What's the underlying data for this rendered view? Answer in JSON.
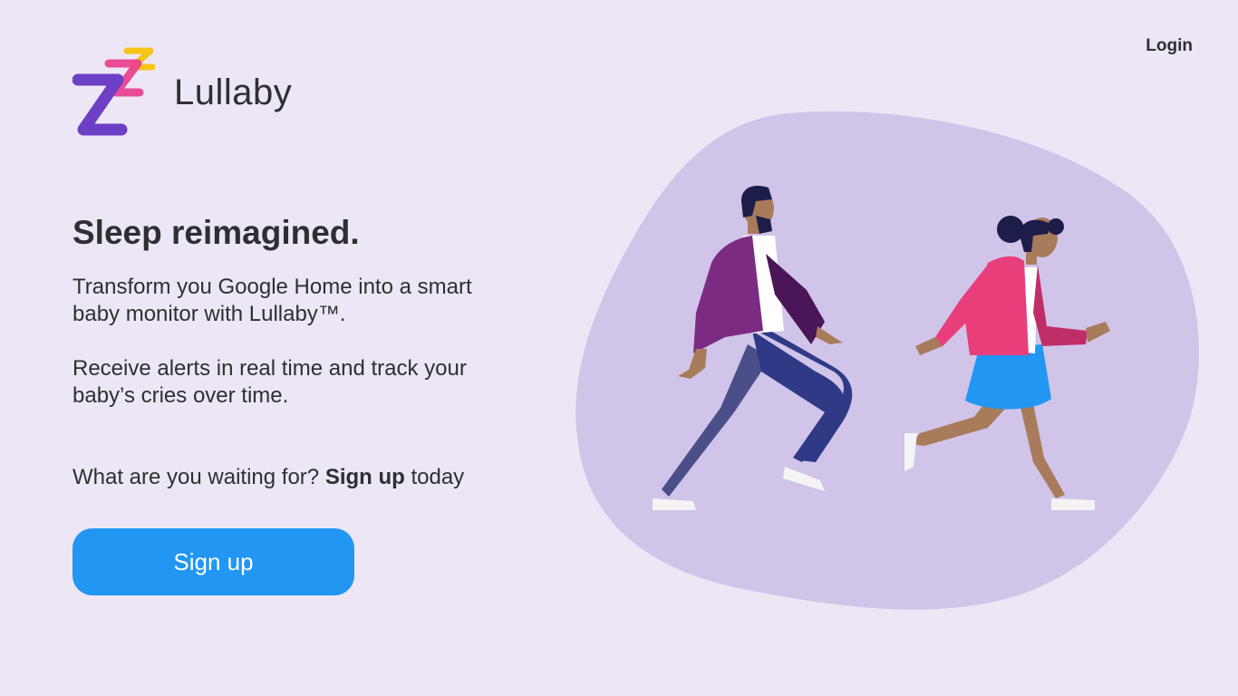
{
  "header": {
    "login_label": "Login"
  },
  "brand": {
    "name": "Lullaby",
    "logo_icon": "zzz-logo-icon",
    "logo_colors": [
      "#6c3fc4",
      "#e83e8c",
      "#f5c518"
    ]
  },
  "hero": {
    "headline": "Sleep reimagined.",
    "paragraph_1": "Transform you Google Home into a smart baby monitor with Lullaby™.",
    "paragraph_2": "Receive alerts in real time and track your baby’s cries over time.",
    "cta_prefix": "What are you waiting for? ",
    "cta_bold": "Sign up",
    "cta_suffix": " today",
    "signup_button_label": "Sign up"
  },
  "illustration": {
    "name": "two-people-running-illustration",
    "blob_color": "#d0c4e8"
  },
  "colors": {
    "background": "#ede7f5",
    "accent": "#2196f3",
    "text": "#2f2f33"
  }
}
